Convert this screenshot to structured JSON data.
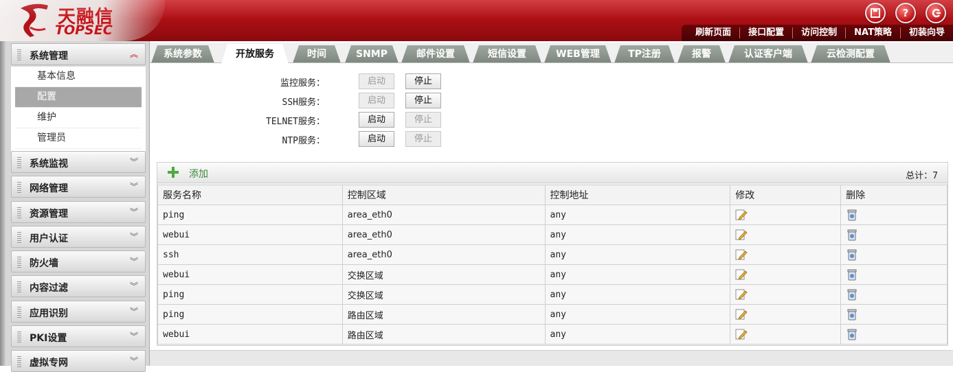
{
  "brand": {
    "name_cn": "天融信",
    "name_en": "TOPSEC"
  },
  "header_icons": [
    {
      "icon": "save-icon"
    },
    {
      "icon": "help-icon"
    },
    {
      "icon": "logout-icon"
    }
  ],
  "topnav": [
    "刷新页面",
    "接口配置",
    "访问控制",
    "NAT策略",
    "初装向导"
  ],
  "sidebar": {
    "groups": [
      {
        "label": "系统管理",
        "expanded": true
      },
      {
        "label": "系统监视"
      },
      {
        "label": "网络管理"
      },
      {
        "label": "资源管理"
      },
      {
        "label": "用户认证"
      },
      {
        "label": "防火墙"
      },
      {
        "label": "内容过滤"
      },
      {
        "label": "应用识别"
      },
      {
        "label": "PKI设置"
      },
      {
        "label": "虚拟专网"
      }
    ],
    "sub_items": [
      "基本信息",
      "配置",
      "维护",
      "管理员"
    ],
    "active_sub": "配置"
  },
  "tabs": [
    "系统参数",
    "开放服务",
    "时间",
    "SNMP",
    "邮件设置",
    "短信设置",
    "WEB管理",
    "TP注册",
    "报警",
    "认证客户端",
    "云检测配置"
  ],
  "active_tab": "开放服务",
  "services": [
    {
      "label": "监控服务：",
      "start": "启动",
      "stop": "停止",
      "running": true
    },
    {
      "label": "SSH服务：",
      "start": "启动",
      "stop": "停止",
      "running": true
    },
    {
      "label": "TELNET服务：",
      "start": "启动",
      "stop": "停止",
      "running": false
    },
    {
      "label": "NTP服务：",
      "start": "启动",
      "stop": "停止",
      "running": false
    }
  ],
  "list": {
    "add_label": "添加",
    "total_label": "总计：7",
    "columns": [
      "服务名称",
      "控制区域",
      "控制地址",
      "修改",
      "删除"
    ],
    "rows": [
      {
        "name": "ping",
        "zone": "area_eth0",
        "addr": "any"
      },
      {
        "name": "webui",
        "zone": "area_eth0",
        "addr": "any"
      },
      {
        "name": "ssh",
        "zone": "area_eth0",
        "addr": "any"
      },
      {
        "name": "webui",
        "zone": "交换区域",
        "addr": "any"
      },
      {
        "name": "ping",
        "zone": "交换区域",
        "addr": "any"
      },
      {
        "name": "ping",
        "zone": "路由区域",
        "addr": "any"
      },
      {
        "name": "webui",
        "zone": "路由区域",
        "addr": "any"
      }
    ],
    "edit_icon": "edit-icon",
    "delete_icon": "delete-icon"
  },
  "colors": {
    "brand_red": "#c8141a",
    "tab_gray": "#8e978f",
    "add_green": "#3a8a3a"
  }
}
